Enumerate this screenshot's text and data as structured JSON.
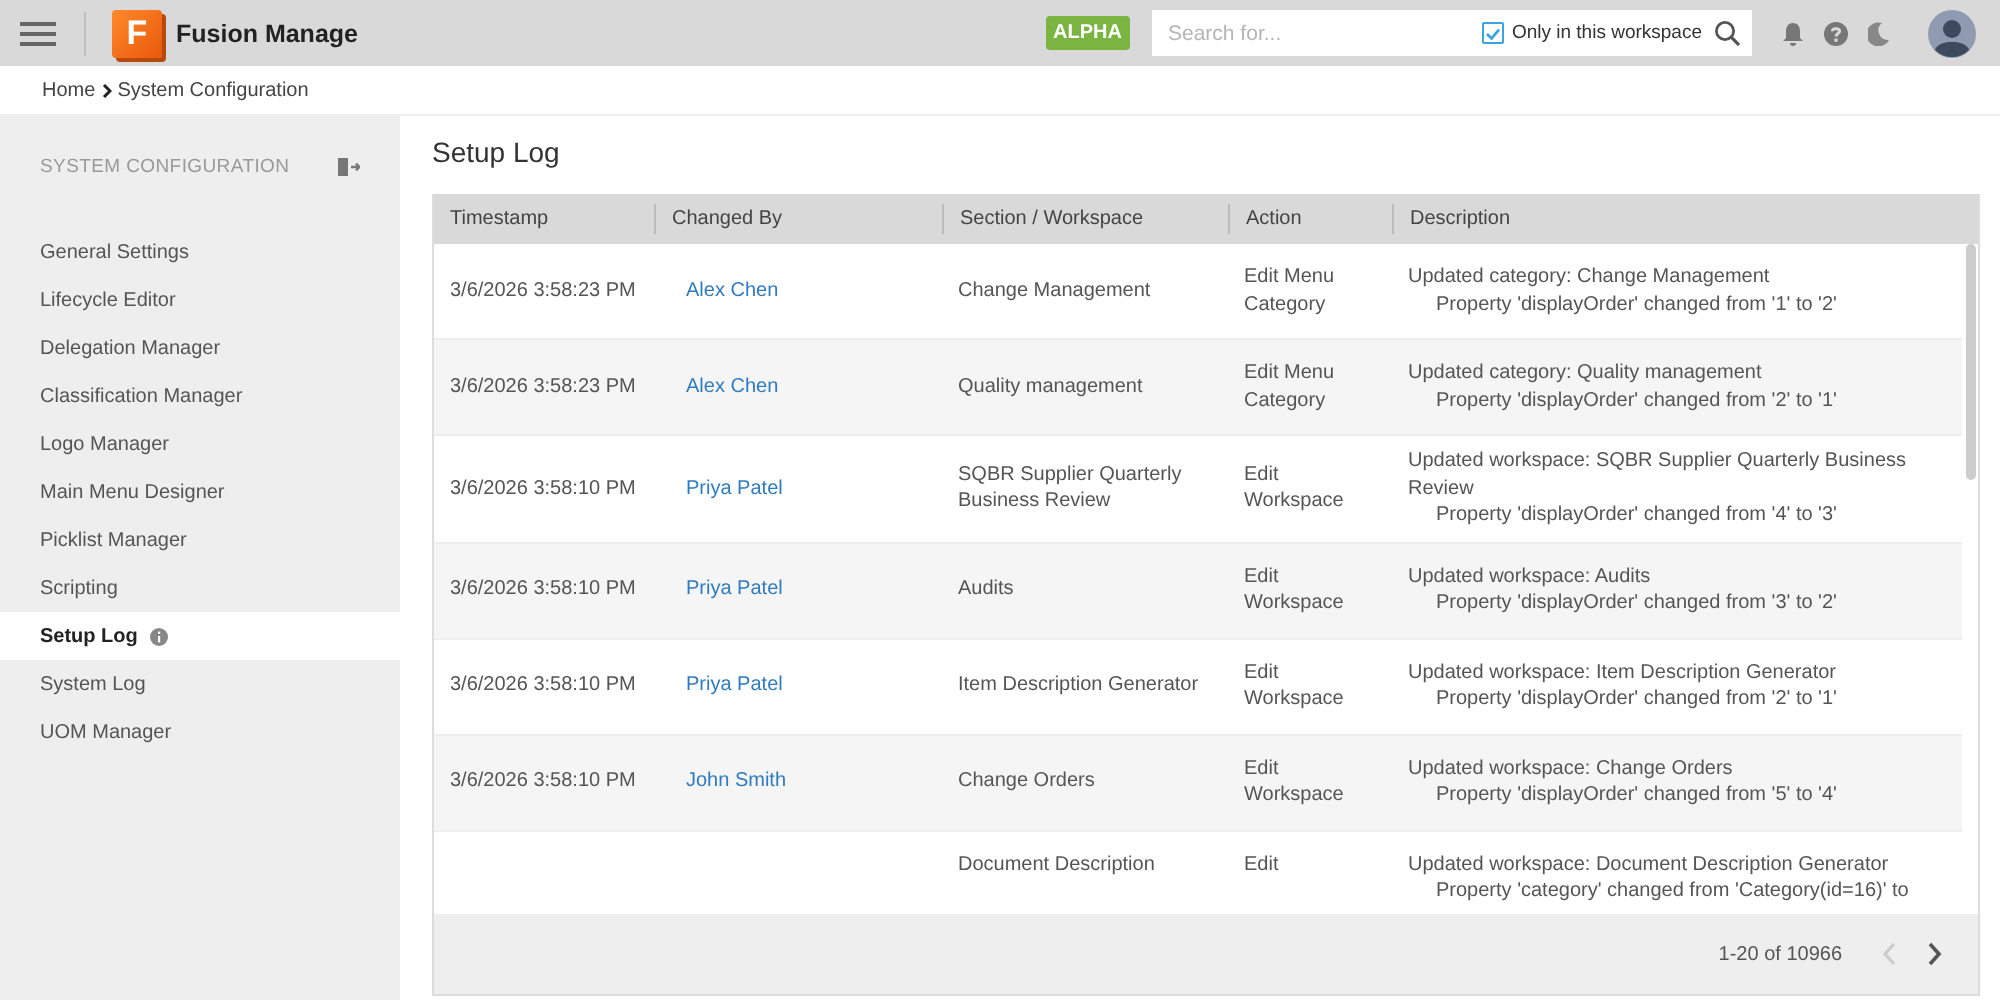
{
  "header": {
    "app_name": "Fusion Manage",
    "logo_letter": "F",
    "badge": "ALPHA",
    "search": {
      "placeholder": "Search for..."
    },
    "workspace_filter": {
      "label": "Only in this workspace",
      "checked": true
    }
  },
  "breadcrumb": [
    "Home",
    "System Configuration"
  ],
  "sidebar": {
    "title": "SYSTEM CONFIGURATION",
    "items": [
      {
        "label": "General Settings",
        "selected": false,
        "info": false
      },
      {
        "label": "Lifecycle Editor",
        "selected": false,
        "info": false
      },
      {
        "label": "Delegation Manager",
        "selected": false,
        "info": false
      },
      {
        "label": "Classification Manager",
        "selected": false,
        "info": false
      },
      {
        "label": "Logo Manager",
        "selected": false,
        "info": false
      },
      {
        "label": "Main Menu Designer",
        "selected": false,
        "info": false
      },
      {
        "label": "Picklist Manager",
        "selected": false,
        "info": false
      },
      {
        "label": "Scripting",
        "selected": false,
        "info": false
      },
      {
        "label": "Setup Log",
        "selected": true,
        "info": true
      },
      {
        "label": "System Log",
        "selected": false,
        "info": false
      },
      {
        "label": "UOM Manager",
        "selected": false,
        "info": false
      }
    ]
  },
  "page": {
    "title": "Setup Log",
    "table": {
      "columns": [
        "Timestamp",
        "Changed By",
        "Section / Workspace",
        "Action",
        "Description"
      ],
      "rows": [
        {
          "timestamp": "3/6/2026 3:58:23 PM",
          "changed_by": "Alex Chen",
          "section": "Change Management",
          "action": "Edit Menu Category",
          "description": [
            "Updated category: Change Management",
            "Property 'displayOrder' changed from '1' to '2'"
          ]
        },
        {
          "timestamp": "3/6/2026 3:58:23 PM",
          "changed_by": "Alex Chen",
          "section": "Quality management",
          "action": "Edit Menu Category",
          "description": [
            "Updated category: Quality management",
            "Property 'displayOrder' changed from '2' to '1'"
          ]
        },
        {
          "timestamp": "3/6/2026 3:58:10 PM",
          "changed_by": "Priya Patel",
          "section": "SQBR Supplier Quarterly Business Review",
          "action": "Edit Workspace",
          "description": [
            "Updated workspace: SQBR Supplier Quarterly Business Review",
            "Property 'displayOrder' changed from '4' to '3'"
          ]
        },
        {
          "timestamp": "3/6/2026 3:58:10 PM",
          "changed_by": "Priya Patel",
          "section": "Audits",
          "action": "Edit Workspace",
          "description": [
            "Updated workspace: Audits",
            "Property 'displayOrder' changed from '3' to '2'"
          ]
        },
        {
          "timestamp": "3/6/2026 3:58:10 PM",
          "changed_by": "Priya Patel",
          "section": "Item Description Generator",
          "action": "Edit Workspace",
          "description": [
            "Updated workspace: Item Description Generator",
            "Property 'displayOrder' changed from '2' to '1'"
          ]
        },
        {
          "timestamp": "3/6/2026 3:58:10 PM",
          "changed_by": "John Smith",
          "section": "Change Orders",
          "action": "Edit Workspace",
          "description": [
            "Updated workspace: Change Orders",
            "Property 'displayOrder' changed from '5' to '4'"
          ]
        },
        {
          "section": "Document Description",
          "action": "Edit",
          "description": [
            "Updated workspace: Document Description Generator",
            "Property 'category' changed from 'Category(id=16)' to"
          ]
        }
      ]
    },
    "pagination": {
      "range": "1-20 of 10966"
    }
  }
}
